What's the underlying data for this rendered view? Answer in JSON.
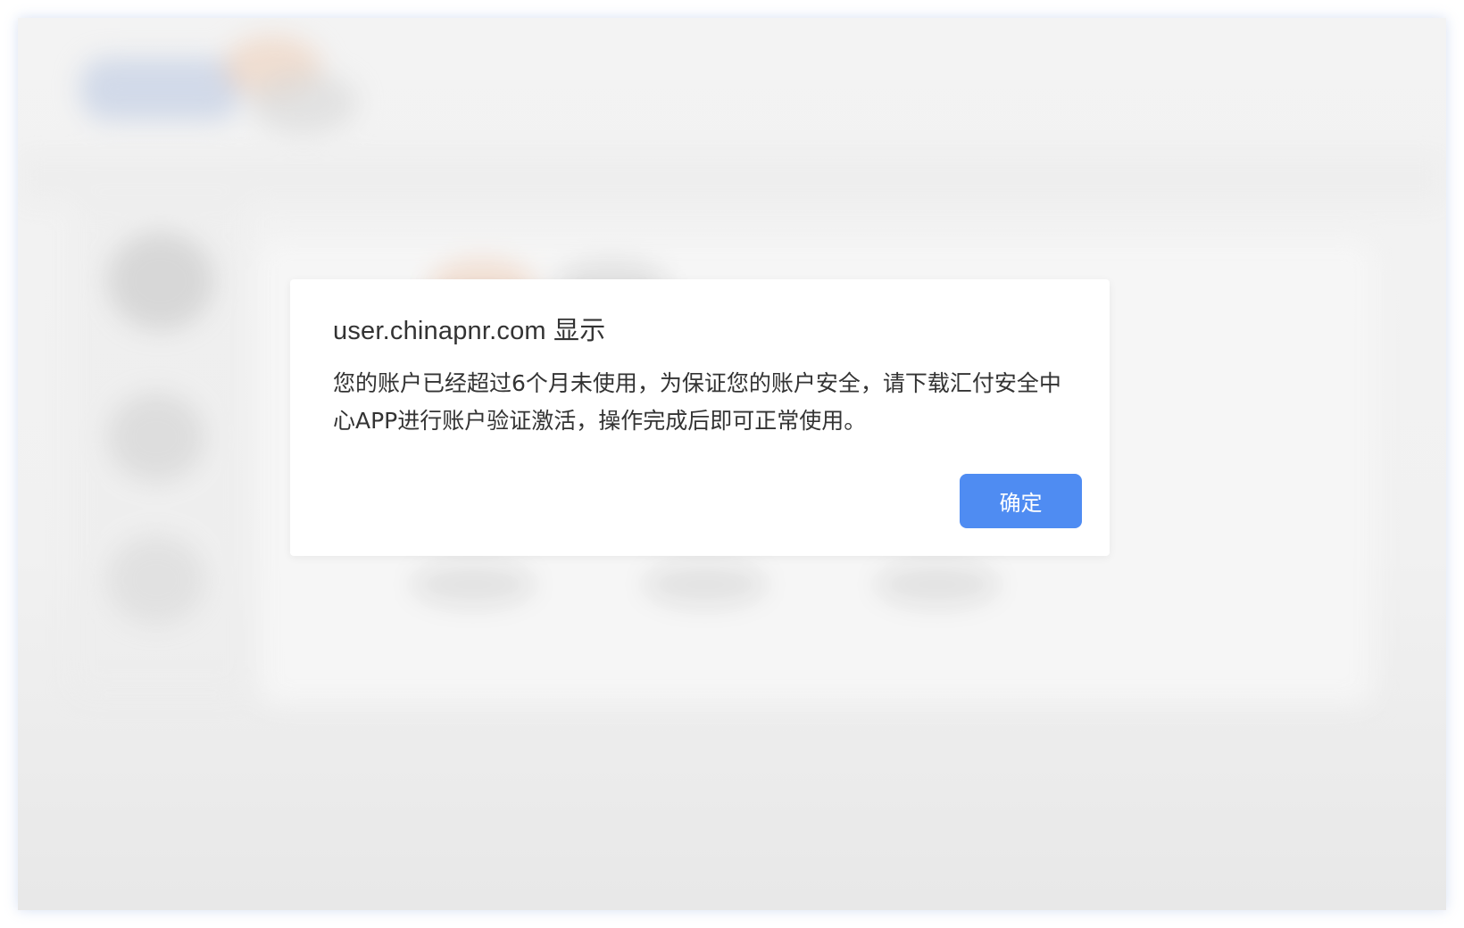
{
  "dialog": {
    "title": "user.chinapnr.com 显示",
    "message": "您的账户已经超过6个月未使用，为保证您的账户安全，请下载汇付安全中心APP进行账户验证激活，操作完成后即可正常使用。",
    "confirm_label": "确定"
  },
  "colors": {
    "accent": "#4f8cf2",
    "dialog_background": "#ffffff",
    "text": "#333333",
    "backdrop": "#f2f2f2"
  }
}
